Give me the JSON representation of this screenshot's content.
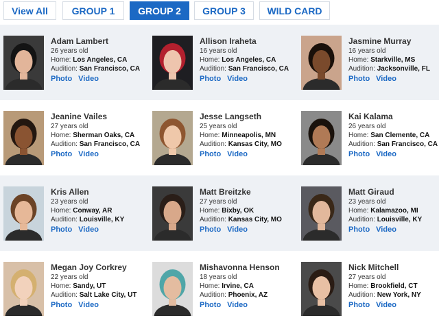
{
  "tabs": [
    {
      "label": "View All",
      "active": false
    },
    {
      "label": "GROUP 1",
      "active": false
    },
    {
      "label": "GROUP 2",
      "active": true
    },
    {
      "label": "GROUP 3",
      "active": false
    },
    {
      "label": "WILD CARD",
      "active": false
    }
  ],
  "labels": {
    "home": "Home:",
    "audition": "Audition:",
    "photo": "Photo",
    "video": "Video"
  },
  "contestants": [
    {
      "name": "Adam Lambert",
      "age": "26 years old",
      "home": "Los Angeles, CA",
      "audition": "San Francisco, CA",
      "portrait": {
        "bg": "#3a3a3a",
        "skin": "#e2b59a",
        "hair": "#141414"
      }
    },
    {
      "name": "Allison Iraheta",
      "age": "16 years old",
      "home": "Los Angeles, CA",
      "audition": "San Francisco, CA",
      "portrait": {
        "bg": "#1e1e22",
        "skin": "#eec5ae",
        "hair": "#b3202e"
      }
    },
    {
      "name": "Jasmine Murray",
      "age": "16 years old",
      "home": "Starkville, MS",
      "audition": "Jacksonville, FL",
      "portrait": {
        "bg": "#caa48c",
        "skin": "#7a4a2c",
        "hair": "#1a100a"
      }
    },
    {
      "name": "Jeanine Vailes",
      "age": "27 years old",
      "home": "Sherman Oaks, CA",
      "audition": "San Francisco, CA",
      "portrait": {
        "bg": "#b89a78",
        "skin": "#8a5432",
        "hair": "#231710"
      }
    },
    {
      "name": "Jesse Langseth",
      "age": "25 years old",
      "home": "Minneapolis, MN",
      "audition": "Kansas City, MO",
      "portrait": {
        "bg": "#b4a890",
        "skin": "#efc8aa",
        "hair": "#8e5630"
      }
    },
    {
      "name": "Kai Kalama",
      "age": "26 years old",
      "home": "San Clemente, CA",
      "audition": "San Francisco, CA",
      "portrait": {
        "bg": "#8a8a8a",
        "skin": "#b07a56",
        "hair": "#1a120c"
      }
    },
    {
      "name": "Kris Allen",
      "age": "23 years old",
      "home": "Conway, AR",
      "audition": "Louisville, KY",
      "portrait": {
        "bg": "#c8d4dc",
        "skin": "#e6b898",
        "hair": "#6b4326"
      }
    },
    {
      "name": "Matt Breitzke",
      "age": "27 years old",
      "home": "Bixby, OK",
      "audition": "Kansas City, MO",
      "portrait": {
        "bg": "#3a3a3a",
        "skin": "#d8a88a",
        "hair": "#2a1e18"
      }
    },
    {
      "name": "Matt Giraud",
      "age": "23 years old",
      "home": "Kalamazoo, MI",
      "audition": "Louisville, KY",
      "portrait": {
        "bg": "#5a5a60",
        "skin": "#e2b89c",
        "hair": "#3a2818"
      }
    },
    {
      "name": "Megan Joy Corkrey",
      "age": "22 years old",
      "home": "Sandy, UT",
      "audition": "Salt Lake City, UT",
      "portrait": {
        "bg": "#d8c0a8",
        "skin": "#f2d2bc",
        "hair": "#d4b070"
      }
    },
    {
      "name": "Mishavonna Henson",
      "age": "18 years old",
      "home": "Irvine, CA",
      "audition": "Phoenix, AZ",
      "portrait": {
        "bg": "#dcdcdc",
        "skin": "#e4bca0",
        "hair": "#4fa6a8"
      }
    },
    {
      "name": "Nick Mitchell",
      "age": "27 years old",
      "home": "Brookfield, CT",
      "audition": "New York, NY",
      "portrait": {
        "bg": "#4a4a4a",
        "skin": "#e8c0a4",
        "hair": "#2a1c14"
      }
    }
  ]
}
